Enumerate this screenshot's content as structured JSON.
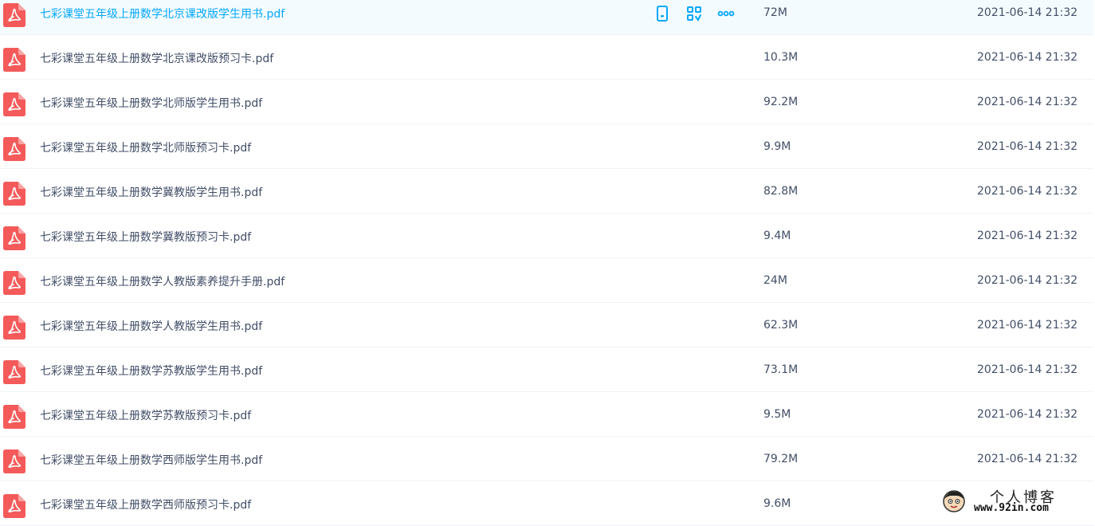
{
  "files": [
    {
      "name": "七彩课堂五年级上册数学北京课改版学生用书.pdf",
      "size": "72M",
      "date": "2021-06-14 21:32",
      "hover": true
    },
    {
      "name": "七彩课堂五年级上册数学北京课改版预习卡.pdf",
      "size": "10.3M",
      "date": "2021-06-14 21:32"
    },
    {
      "name": "七彩课堂五年级上册数学北师版学生用书.pdf",
      "size": "92.2M",
      "date": "2021-06-14 21:32"
    },
    {
      "name": "七彩课堂五年级上册数学北师版预习卡.pdf",
      "size": "9.9M",
      "date": "2021-06-14 21:32"
    },
    {
      "name": "七彩课堂五年级上册数学冀教版学生用书.pdf",
      "size": "82.8M",
      "date": "2021-06-14 21:32"
    },
    {
      "name": "七彩课堂五年级上册数学冀教版预习卡.pdf",
      "size": "9.4M",
      "date": "2021-06-14 21:32"
    },
    {
      "name": "七彩课堂五年级上册数学人教版素养提升手册.pdf",
      "size": "24M",
      "date": "2021-06-14 21:32"
    },
    {
      "name": "七彩课堂五年级上册数学人教版学生用书.pdf",
      "size": "62.3M",
      "date": "2021-06-14 21:32"
    },
    {
      "name": "七彩课堂五年级上册数学苏教版学生用书.pdf",
      "size": "73.1M",
      "date": "2021-06-14 21:32"
    },
    {
      "name": "七彩课堂五年级上册数学苏教版预习卡.pdf",
      "size": "9.5M",
      "date": "2021-06-14 21:32"
    },
    {
      "name": "七彩课堂五年级上册数学西师版学生用书.pdf",
      "size": "79.2M",
      "date": "2021-06-14 21:32"
    },
    {
      "name": "七彩课堂五年级上册数学西师版预习卡.pdf",
      "size": "9.6M",
      "date": ""
    }
  ],
  "icons": {
    "file": "pdf-file-icon",
    "actions": [
      "phone-icon",
      "share-link-icon",
      "more-icon"
    ]
  },
  "colors": {
    "pdf_red": "#f45a5a",
    "accent": "#06a7ff",
    "hover_bg": "#f4fbff",
    "text": "#424e67"
  },
  "watermark": {
    "title": "个人博客",
    "url": "www.92in.com"
  }
}
